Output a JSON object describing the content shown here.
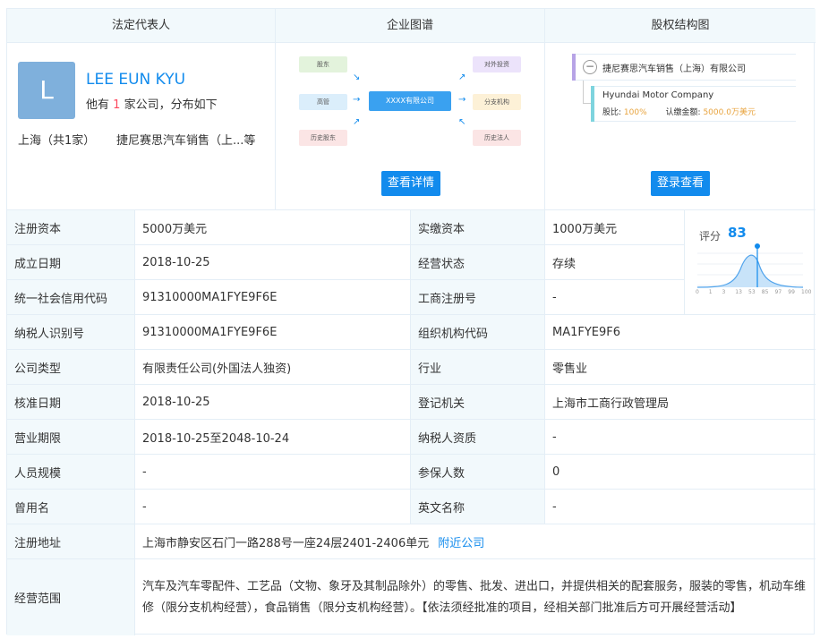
{
  "headers": {
    "legal_rep": "法定代表人",
    "graph": "企业图谱",
    "equity": "股权结构图"
  },
  "legal_rep": {
    "avatar_letter": "L",
    "name": "LEE EUN KYU",
    "sub_prefix": "他有",
    "sub_count": "1",
    "sub_suffix": "家公司，分布如下",
    "city": "上海（共1家）",
    "company": "捷尼赛思汽车销售（上...等"
  },
  "graph": {
    "nodes": [
      "股东",
      "高管",
      "历史股东",
      "XXXX有限公司",
      "对外投资",
      "分支机构",
      "历史法人"
    ],
    "button": "查看详情"
  },
  "equity": {
    "company": "捷尼赛思汽车销售（上海）有限公司",
    "holder": "Hyundai Motor Company",
    "ratio_label": "股比:",
    "ratio_value": "100%",
    "amount_label": "认缴金额:",
    "amount_value": "5000.0万美元",
    "button": "登录查看"
  },
  "score": {
    "label": "评分",
    "value": "83",
    "ticks": [
      "0",
      "1",
      "3",
      "13",
      "53",
      "85",
      "97",
      "99",
      "100"
    ]
  },
  "table": {
    "rows": [
      {
        "l1": "注册资本",
        "v1": "5000万美元",
        "l2": "实缴资本",
        "v2": "1000万美元"
      },
      {
        "l1": "成立日期",
        "v1": "2018-10-25",
        "l2": "经营状态",
        "v2": "存续"
      },
      {
        "l1": "统一社会信用代码",
        "v1": "91310000MA1FYE9F6E",
        "l2": "工商注册号",
        "v2": "-"
      },
      {
        "l1": "纳税人识别号",
        "v1": "91310000MA1FYE9F6E",
        "l2": "组织机构代码",
        "v2": "MA1FYE9F6"
      },
      {
        "l1": "公司类型",
        "v1": "有限责任公司(外国法人独资)",
        "l2": "行业",
        "v2": "零售业"
      },
      {
        "l1": "核准日期",
        "v1": "2018-10-25",
        "l2": "登记机关",
        "v2": "上海市工商行政管理局"
      },
      {
        "l1": "营业期限",
        "v1": "2018-10-25至2048-10-24",
        "l2": "纳税人资质",
        "v2": "-"
      },
      {
        "l1": "人员规模",
        "v1": "-",
        "l2": "参保人数",
        "v2": "0"
      },
      {
        "l1": "曾用名",
        "v1": "-",
        "l2": "英文名称",
        "v2": "-"
      }
    ],
    "address_label": "注册地址",
    "address_value": "上海市静安区石门一路288号一座24层2401-2406单元",
    "address_link": "附近公司",
    "scope_label": "经营范围",
    "scope_value": "汽车及汽车零配件、工艺品（文物、象牙及其制品除外）的零售、批发、进出口，并提供相关的配套服务，服装的零售，机动车维修（限分支机构经营），食品销售（限分支机构经营）。【依法须经批准的项目，经相关部门批准后方可开展经营活动】"
  }
}
